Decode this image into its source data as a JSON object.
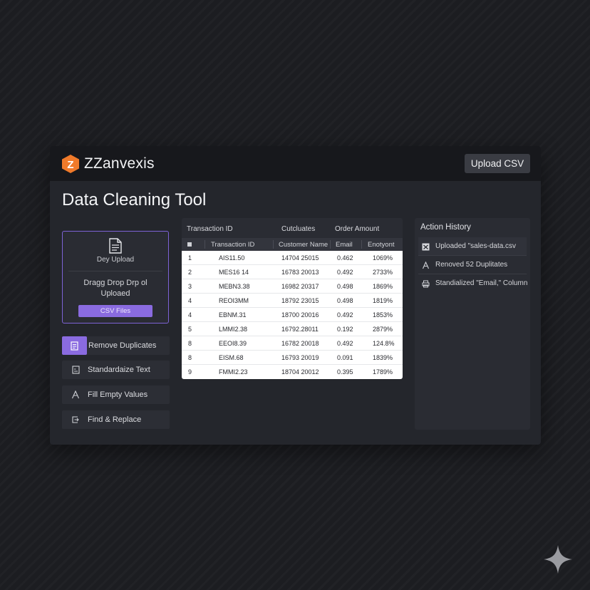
{
  "app": {
    "brand": "ZZanvexis",
    "logo_letter": "Z",
    "upload_label": "Upload CSV"
  },
  "page": {
    "title": "Data Cleaning Tool"
  },
  "dropzone": {
    "small_label": "Dey Upload",
    "main_text": "Dragg Drop Drp ol Uploaed",
    "button_label": "CSV Files"
  },
  "actions": [
    {
      "label": "Remove Duplicates",
      "icon": "document-icon",
      "active": true
    },
    {
      "label": "Standardaize Text",
      "icon": "text-format-icon",
      "active": false
    },
    {
      "label": "Fill Empty Values",
      "icon": "font-icon",
      "active": false
    },
    {
      "label": "Find & Replace",
      "icon": "replace-icon",
      "active": false
    }
  ],
  "table": {
    "top_headers": [
      "Transaction ID",
      "Cutcluates",
      "Order Amount"
    ],
    "headers": [
      "Transaction ID",
      "Customer Name",
      "Email",
      "Enotyont"
    ],
    "rows": [
      [
        "1",
        "AIS11.50",
        "14704 25015",
        "0.462",
        "1069%"
      ],
      [
        "2",
        "MES16 14",
        "16783 20013",
        "0.492",
        "2733%"
      ],
      [
        "3",
        "MEBN3.38",
        "16982 20317",
        "0.498",
        "1869%"
      ],
      [
        "4",
        "REOI3MM",
        "18792 23015",
        "0.498",
        "1819%"
      ],
      [
        "4",
        "EBNM.31",
        "18700 20016",
        "0.492",
        "1853%"
      ],
      [
        "5",
        "LMMI2.38",
        "16792.28011",
        "0.192",
        "2879%"
      ],
      [
        "8",
        "EEOI8.39",
        "16782 20018",
        "0.492",
        "124.8%"
      ],
      [
        "8",
        "EISM.68",
        "16793 20019",
        "0.091",
        "1839%"
      ],
      [
        "9",
        "FMMI2.23",
        "18704 20012",
        "0.395",
        "1789%"
      ]
    ]
  },
  "history": {
    "title": "Action History",
    "items": [
      {
        "text": "Uploaded \"sales-data.csv",
        "icon": "check-box-icon"
      },
      {
        "text": "Renoved 52 Duplitates",
        "icon": "font-icon"
      },
      {
        "text": "Standialized \"Email,\" Column",
        "icon": "print-icon"
      }
    ]
  },
  "colors": {
    "accent": "#8a6be0",
    "logo": "#f07a2a",
    "panel": "#2a2c33",
    "topbar": "#17181c"
  }
}
